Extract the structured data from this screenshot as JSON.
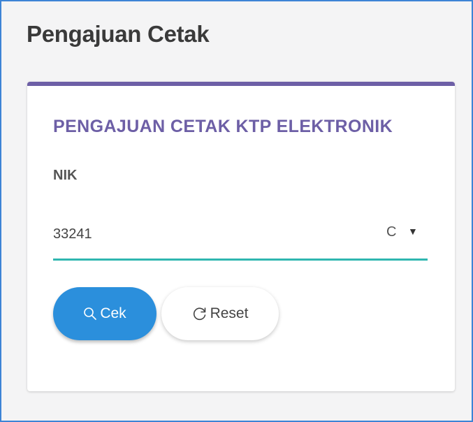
{
  "page": {
    "title": "Pengajuan Cetak"
  },
  "card": {
    "title": "PENGAJUAN CETAK KTP ELEKTRONIK",
    "accent_color": "#6d5fa6"
  },
  "form": {
    "nik_label": "NIK",
    "nik_value": "33241",
    "trailing_char": "C",
    "dropdown_icon": "caret-down-icon",
    "underline_color": "#2fb6b0"
  },
  "buttons": {
    "cek": {
      "label": "Cek",
      "icon": "search-icon",
      "color": "#2b8fdc"
    },
    "reset": {
      "label": "Reset",
      "icon": "refresh-icon"
    }
  }
}
